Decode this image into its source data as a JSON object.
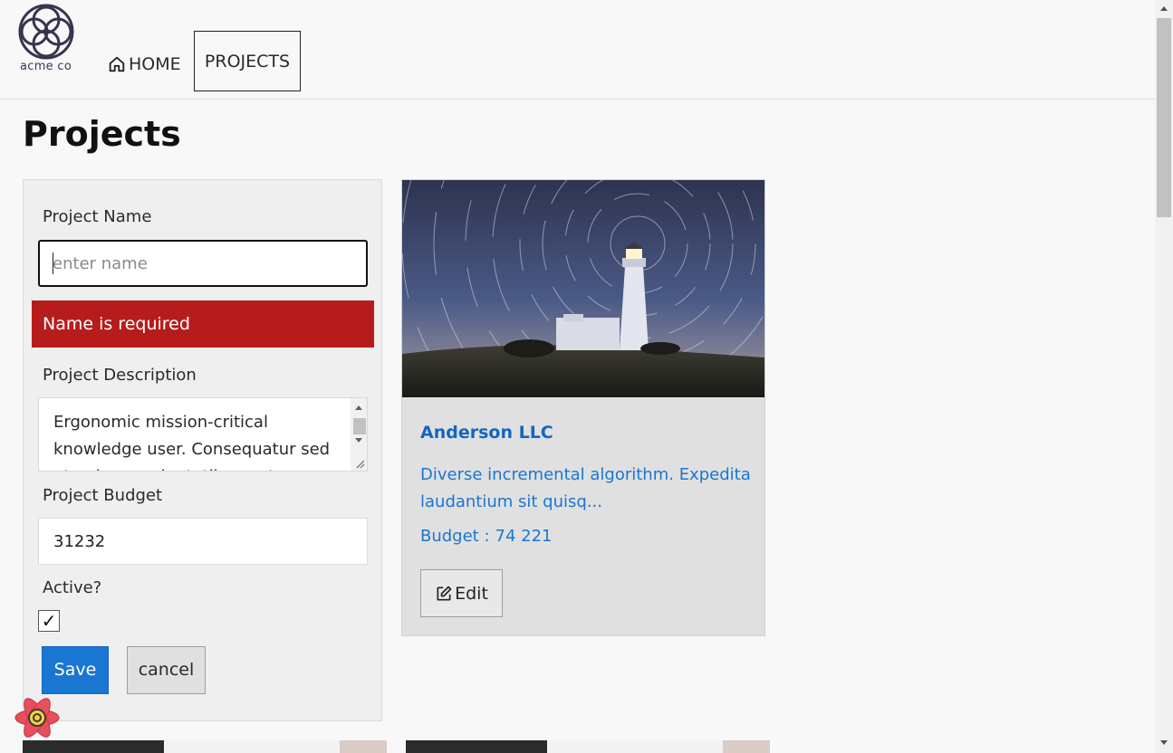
{
  "brand": {
    "logo_text": "acme co"
  },
  "nav": {
    "home_label": "HOME",
    "projects_label": "PROJECTS"
  },
  "page": {
    "title": "Projects"
  },
  "form": {
    "name_label": "Project Name",
    "name_value": "",
    "name_placeholder": "enter name",
    "name_error": "Name is required",
    "description_label": "Project Description",
    "description_value": "Ergonomic mission-critical knowledge user. Consequatur sed et qui quo voluptatibus aut",
    "budget_label": "Project Budget",
    "budget_value": "31232",
    "active_label": "Active?",
    "active_checked": true,
    "active_mark": "✓",
    "save_label": "Save",
    "cancel_label": "cancel"
  },
  "card": {
    "title": "Anderson LLC",
    "description": "Diverse incremental algorithm. Expedita laudantium sit quisq...",
    "budget_label": "Budget :",
    "budget_value": "74 221",
    "edit_label": "Edit"
  },
  "colors": {
    "primary": "#1976d2",
    "error": "#b71c1c",
    "card_bg": "#e0e0e0",
    "form_bg": "#efefef",
    "link": "#1565c0"
  },
  "icons": {
    "logo": "interlocking-circles-logo-icon",
    "home": "home-icon",
    "edit": "edit-icon",
    "react": "react-devtools-icon"
  }
}
